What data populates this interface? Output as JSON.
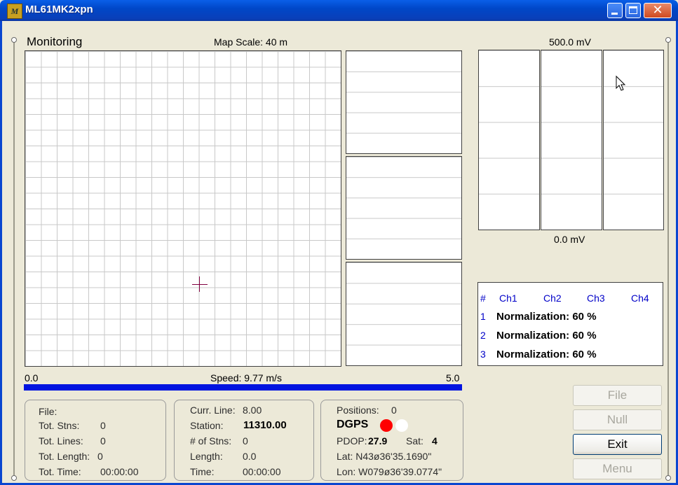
{
  "window": {
    "title": "ML61MK2xpn",
    "icon": "app-icon"
  },
  "monitoring": {
    "heading": "Monitoring",
    "map_scale": "Map Scale:  40 m"
  },
  "mv": {
    "top": "500.0 mV",
    "bottom": "0.0 mV"
  },
  "speed": {
    "min": "0.0",
    "max": "5.0",
    "label": "Speed:  9.77 m/s",
    "fraction": 1.0,
    "bar_color": "#0014e0"
  },
  "channels": {
    "headers": [
      "#",
      "Ch1",
      "Ch2",
      "Ch3",
      "Ch4"
    ],
    "rows": [
      {
        "n": "1",
        "text": "Normalization:  60 %"
      },
      {
        "n": "2",
        "text": "Normalization:  60 %"
      },
      {
        "n": "3",
        "text": "Normalization:  60 %"
      }
    ]
  },
  "file_box": {
    "file_label": "File:",
    "tot_stns_label": "Tot. Stns:",
    "tot_stns": "0",
    "tot_lines_label": "Tot. Lines:",
    "tot_lines": "0",
    "tot_length_label": "Tot. Length:",
    "tot_length": "0",
    "tot_time_label": "Tot. Time:",
    "tot_time": "00:00:00"
  },
  "line_box": {
    "curr_line_label": "Curr. Line:",
    "curr_line": "8.00",
    "station_label": "Station:",
    "station": "11310.00",
    "num_stns_label": "# of Stns:",
    "num_stns": "0",
    "length_label": "Length:",
    "length": "0.0",
    "time_label": "Time:",
    "time": "00:00:00"
  },
  "gps_box": {
    "positions_label": "Positions:",
    "positions": "0",
    "dgps_label": "DGPS",
    "pdop_label": "PDOP:",
    "pdop": "27.9",
    "sat_label": "Sat:",
    "sat": "4",
    "lat": "Lat:  N43ø36'35.1690\"",
    "lon": "Lon:  W079ø36'39.0774\"",
    "indicator_colors": [
      "#ff0000",
      "#ffffff"
    ]
  },
  "buttons": {
    "file": {
      "label": "File",
      "enabled": false
    },
    "null": {
      "label": "Null",
      "enabled": false
    },
    "exit": {
      "label": "Exit",
      "enabled": true
    },
    "menu": {
      "label": "Menu",
      "enabled": false
    }
  }
}
